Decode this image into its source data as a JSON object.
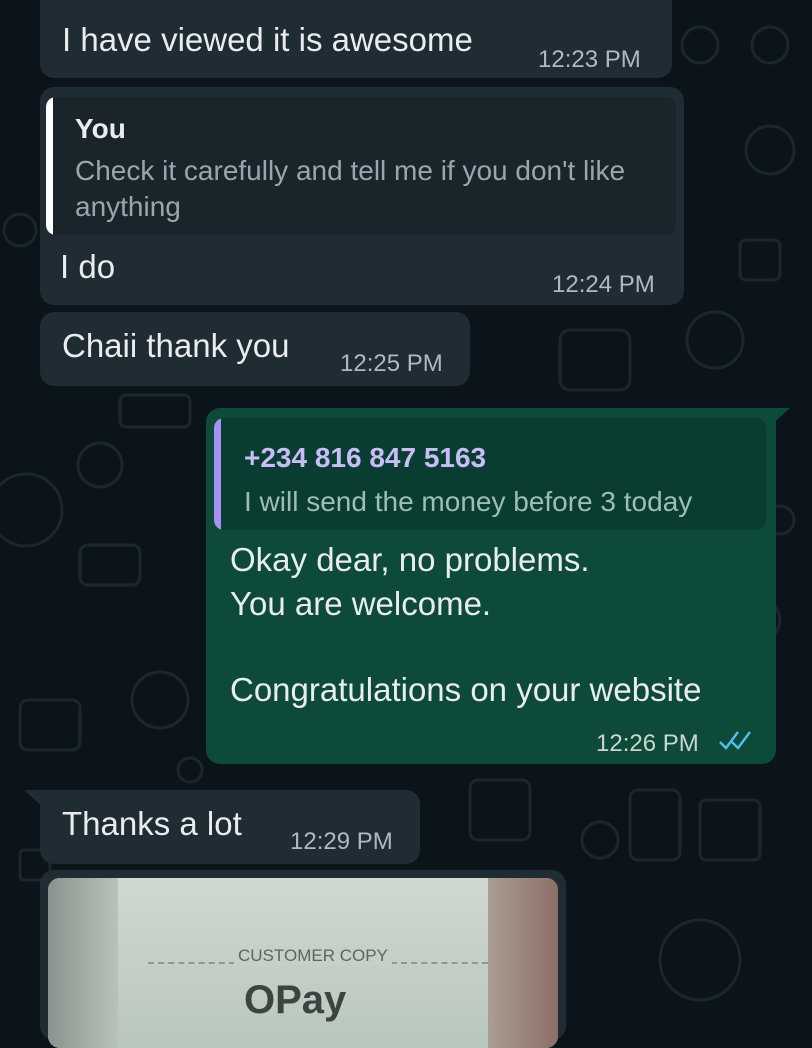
{
  "messages": [
    {
      "text": "I have viewed it is awesome",
      "time": "12:23 PM"
    },
    {
      "quote_author": "You",
      "quote_text": "Check it carefully and tell me if you don't like anything",
      "text": "I do",
      "time": "12:24 PM"
    },
    {
      "text": "Chaii thank you",
      "time": "12:25 PM"
    },
    {
      "quote_author": "+234 816 847 5163",
      "quote_text": "I will send the money before 3 today",
      "line1": "Okay dear, no problems.",
      "line2": "You are welcome.",
      "line3": "Congratulations on your website",
      "time": "12:26 PM",
      "status": "read"
    },
    {
      "text": "Thanks a lot",
      "time": "12:29 PM"
    },
    {
      "photo_caption_line": "CUSTOMER COPY",
      "photo_logo": "OPay"
    }
  ],
  "colors": {
    "background": "#0b141a",
    "incoming_bubble": "#1f2c34",
    "outgoing_bubble": "#0d4a3a",
    "quote_bar_you": "#ffffff",
    "quote_bar_contact": "#a791f2",
    "read_tick": "#53bdeb"
  },
  "icons": [
    "double-check-icon"
  ]
}
